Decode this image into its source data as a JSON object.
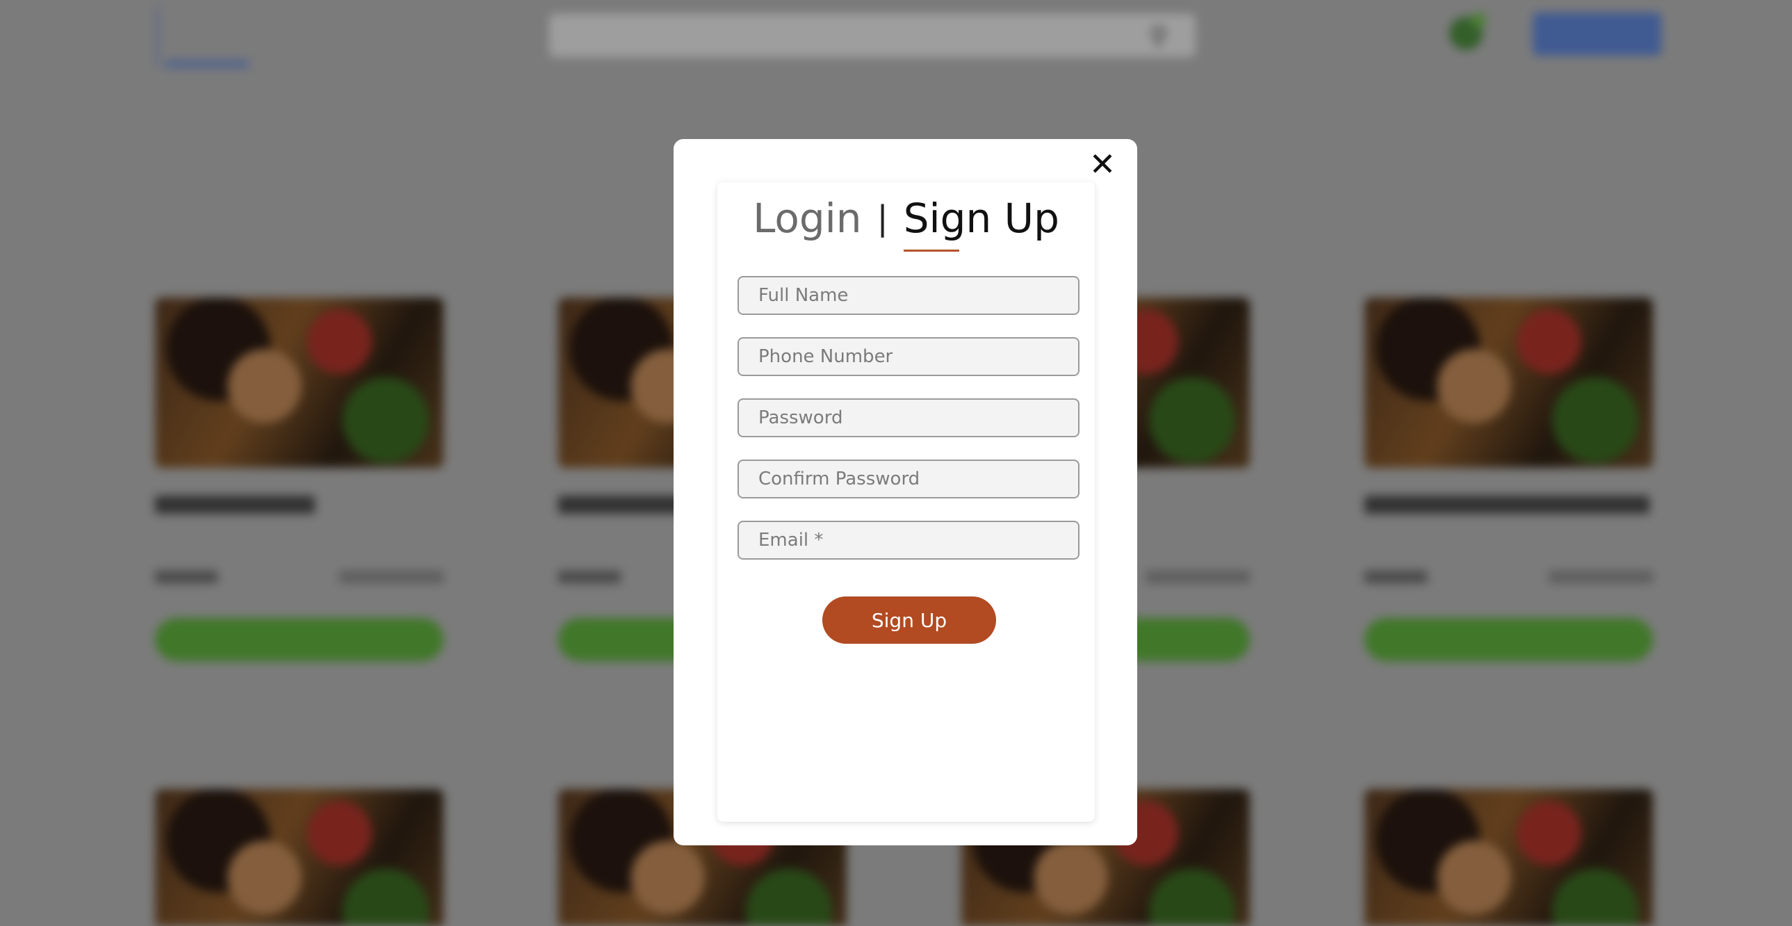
{
  "modal": {
    "tabs": {
      "login": "Login",
      "separator": "|",
      "signup": "Sign Up"
    },
    "fields": {
      "full_name": "Full Name",
      "phone": "Phone Number",
      "password": "Password",
      "confirm_password": "Confirm Password",
      "email": "Email *"
    },
    "submit_label": "Sign Up",
    "close_icon": "close-icon"
  },
  "colors": {
    "accent": "#b24a22",
    "overlay": "rgba(0,0,0,0.32)",
    "modal_bg": "#ffffff"
  }
}
